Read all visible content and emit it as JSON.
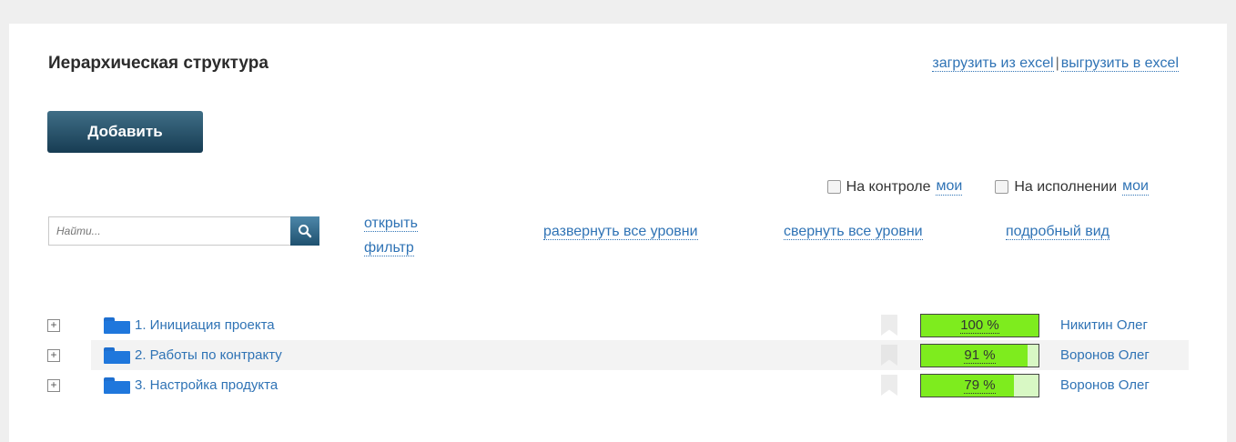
{
  "header": {
    "title": "Иерархическая структура",
    "import_excel": "загрузить из excel",
    "separator": "|",
    "export_excel": "выгрузить в excel"
  },
  "toolbar": {
    "add_label": "Добавить",
    "control_label": "На контроле",
    "control_mine": "мои",
    "execution_label": "На исполнении",
    "execution_mine": "мои",
    "search_placeholder": "Найти...",
    "open_filter_line1": "открыть",
    "open_filter_line2": "фильтр",
    "expand_all": "развернуть все уровни",
    "collapse_all": "свернуть все уровни",
    "detailed_view": "подробный вид"
  },
  "tasks": [
    {
      "expander": "+",
      "name": "1. Инициация проекта",
      "progress_label": "100 %",
      "progress": 1.0,
      "owner": "Никитин Олег"
    },
    {
      "expander": "+",
      "name": "2. Работы по контракту",
      "progress_label": "91 %",
      "progress": 0.91,
      "owner": "Воронов Олег"
    },
    {
      "expander": "+",
      "name": "3. Настройка продукта",
      "progress_label": "79 %",
      "progress": 0.79,
      "owner": "Воронов Олег"
    }
  ],
  "colors": {
    "accent_link": "#2f73b5",
    "button_dark": "#173c53",
    "progress_fill": "#7eec1e",
    "progress_empty": "#d8f8c4",
    "folder": "#1f77dc"
  }
}
